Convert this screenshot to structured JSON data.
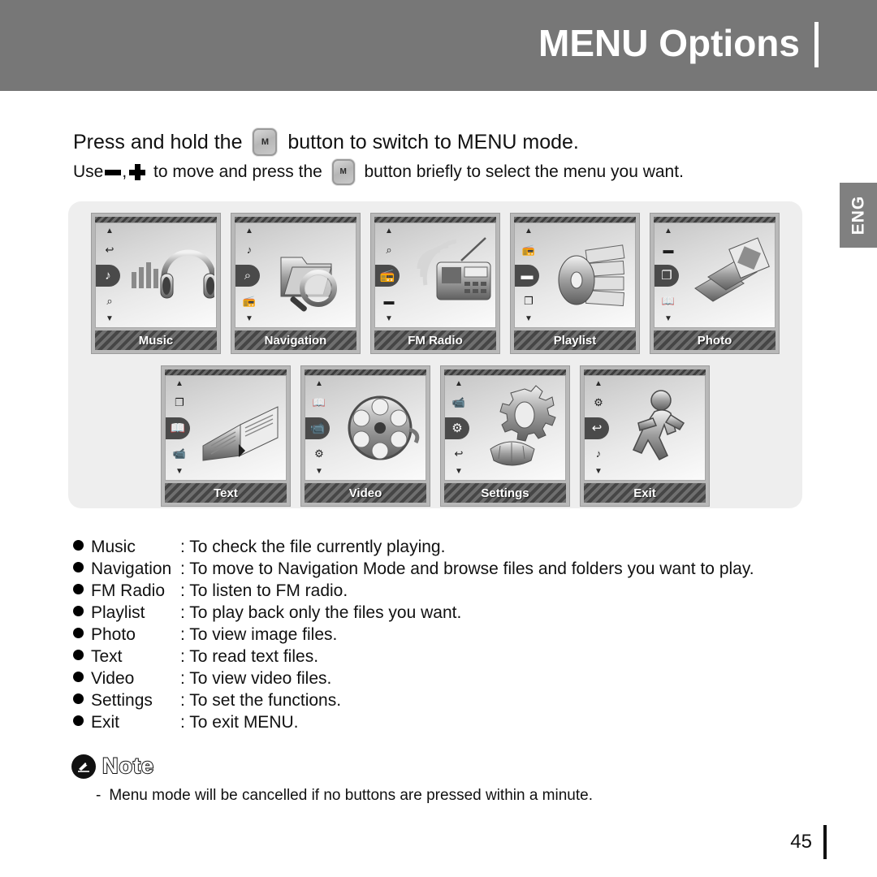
{
  "header": {
    "title": "MENU Options"
  },
  "language_tab": {
    "label": "ENG"
  },
  "intro": {
    "line1_before": "Press and hold the ",
    "line1_button": "M",
    "line1_after": " button to switch to MENU mode.",
    "line2_before": "Use",
    "line2_comma": ",",
    "line2_middle": " to move and press the ",
    "line2_button": "M",
    "line2_after": " button briefly to select the menu you want."
  },
  "screens": {
    "row1": [
      {
        "label": "Music",
        "art_icon": "headphones-equalizer-art",
        "rail": [
          "up-arrow-icon",
          "exit-icon",
          "music-note-icon",
          "magnifier-icon",
          "down-arrow-icon"
        ],
        "selected_index": 2
      },
      {
        "label": "Navigation",
        "art_icon": "folders-magnifier-art",
        "rail": [
          "up-arrow-icon",
          "music-note-icon",
          "magnifier-icon",
          "radio-icon",
          "down-arrow-icon"
        ],
        "selected_index": 2
      },
      {
        "label": "FM Radio",
        "art_icon": "radio-waves-art",
        "rail": [
          "up-arrow-icon",
          "magnifier-icon",
          "radio-icon",
          "folder-icon",
          "down-arrow-icon"
        ],
        "selected_index": 2
      },
      {
        "label": "Playlist",
        "art_icon": "disc-documents-art",
        "rail": [
          "up-arrow-icon",
          "radio-icon",
          "folder-icon",
          "photo-icon",
          "down-arrow-icon"
        ],
        "selected_index": 2
      },
      {
        "label": "Photo",
        "art_icon": "photo-album-art",
        "rail": [
          "up-arrow-icon",
          "folder-icon",
          "photo-icon",
          "text-book-icon",
          "down-arrow-icon"
        ],
        "selected_index": 2
      }
    ],
    "row2": [
      {
        "label": "Text",
        "art_icon": "open-book-art",
        "rail": [
          "up-arrow-icon",
          "photo-icon",
          "text-book-icon",
          "video-camera-icon",
          "down-arrow-icon"
        ],
        "selected_index": 2
      },
      {
        "label": "Video",
        "art_icon": "film-reel-art",
        "rail": [
          "up-arrow-icon",
          "text-book-icon",
          "video-camera-icon",
          "gear-icon",
          "down-arrow-icon"
        ],
        "selected_index": 2
      },
      {
        "label": "Settings",
        "art_icon": "gears-art",
        "rail": [
          "up-arrow-icon",
          "video-camera-icon",
          "gear-icon",
          "exit-icon",
          "down-arrow-icon"
        ],
        "selected_index": 2
      },
      {
        "label": "Exit",
        "art_icon": "running-person-art",
        "rail": [
          "up-arrow-icon",
          "gear-icon",
          "exit-icon",
          "music-note-icon",
          "down-arrow-icon"
        ],
        "selected_index": 2
      }
    ]
  },
  "descriptions": [
    {
      "term": "Music",
      "definition": ": To check the file currently playing."
    },
    {
      "term": "Navigation",
      "definition": ": To move to Navigation Mode and browse files and folders you want to play."
    },
    {
      "term": "FM Radio",
      "definition": ": To listen to FM radio."
    },
    {
      "term": "Playlist",
      "definition": ": To play back only the files you want."
    },
    {
      "term": "Photo",
      "definition": ": To view image files."
    },
    {
      "term": "Text",
      "definition": ": To read text files."
    },
    {
      "term": "Video",
      "definition": ": To view video files."
    },
    {
      "term": "Settings",
      "definition": ": To set the functions."
    },
    {
      "term": "Exit",
      "definition": ": To exit MENU."
    }
  ],
  "note": {
    "title": "Note",
    "dash": "-",
    "text": "Menu mode will be cancelled if no buttons are pressed within a minute."
  },
  "footer": {
    "page_number": "45"
  },
  "colors": {
    "header_gray": "#777777",
    "panel_gray": "#eeeeee",
    "label_bar": "#4f4f4f",
    "tab_gray": "#808080"
  }
}
